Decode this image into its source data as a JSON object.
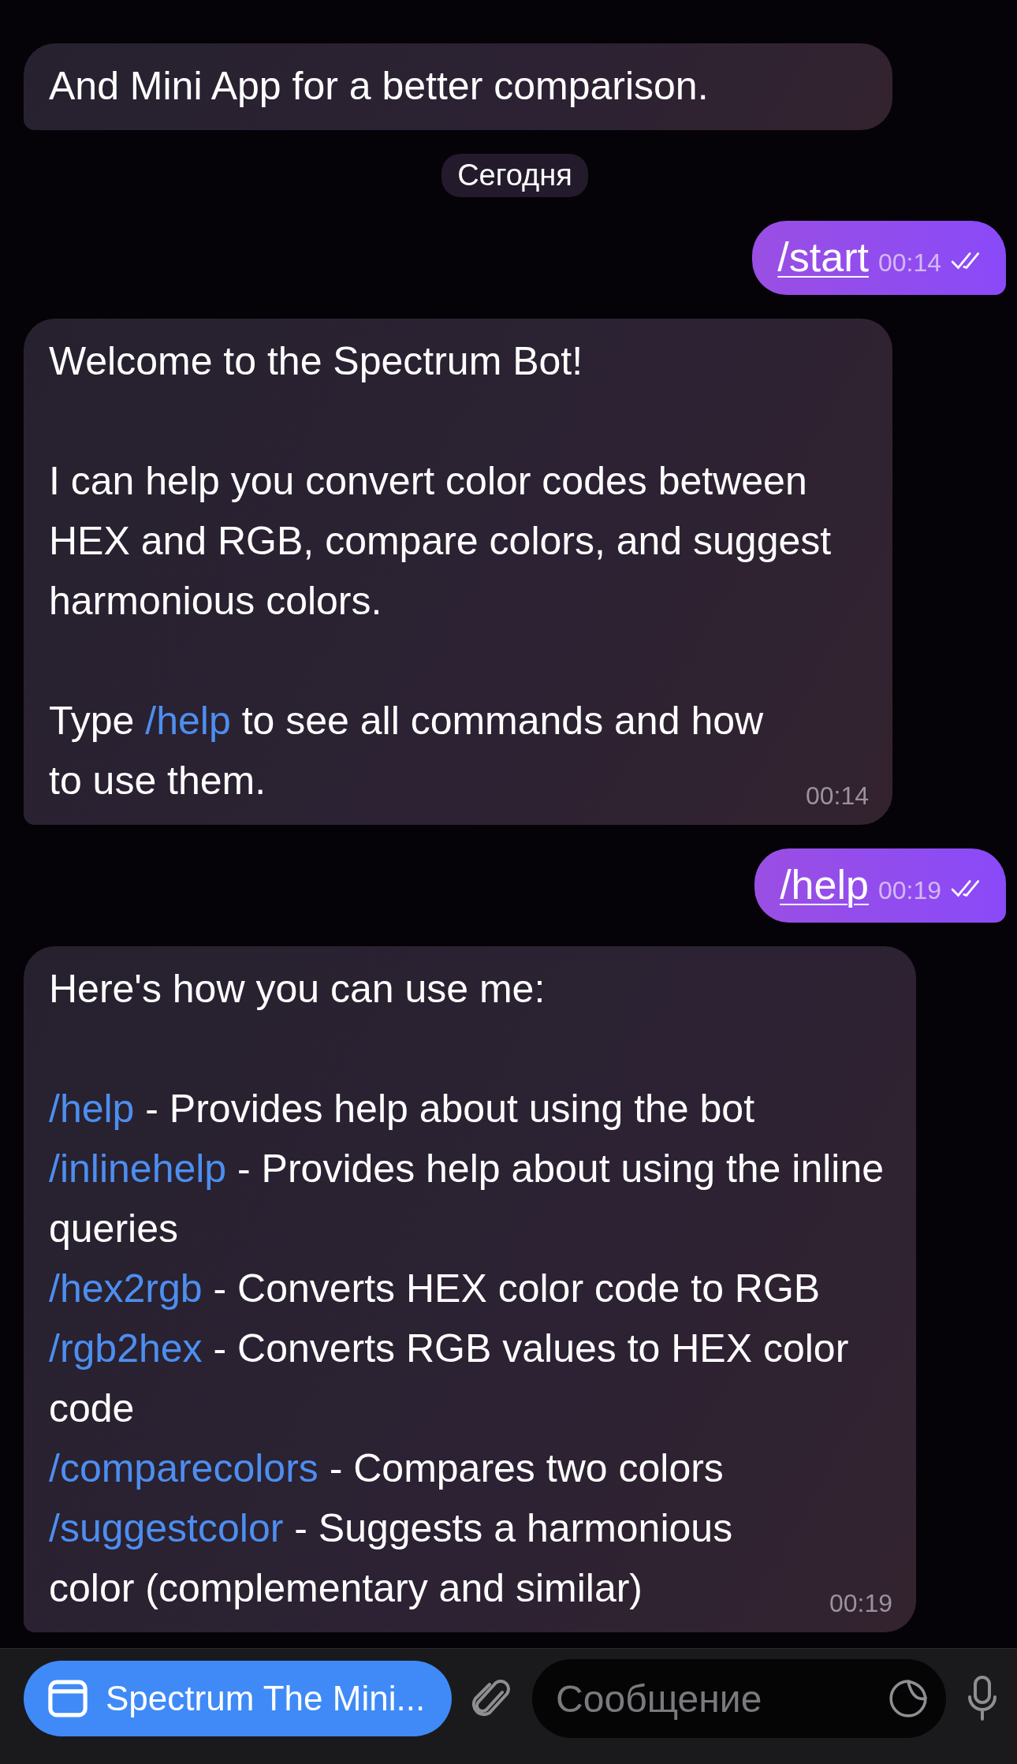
{
  "messages": [
    {
      "kind": "incoming",
      "paragraphs": [
        [
          [
            {
              "kind": "text",
              "text": "And Mini App for a better comparison."
            }
          ]
        ]
      ]
    },
    {
      "kind": "date",
      "text": "Сегодня"
    },
    {
      "kind": "outgoing",
      "text": "/start",
      "time": "00:14",
      "read": true
    },
    {
      "kind": "incoming",
      "time": "00:14",
      "paragraphs": [
        [
          [
            {
              "kind": "text",
              "text": "Welcome to the Spectrum Bot!"
            }
          ]
        ],
        [
          [
            {
              "kind": "text",
              "text": "I can help you convert color codes between HEX and RGB, compare colors, and suggest harmonious colors."
            }
          ]
        ],
        [
          [
            {
              "kind": "text",
              "text": "Type "
            },
            {
              "kind": "command",
              "text": "/help"
            },
            {
              "kind": "text",
              "text": " to see all commands and how to use them."
            }
          ]
        ]
      ]
    },
    {
      "kind": "outgoing",
      "text": "/help",
      "time": "00:19",
      "read": true
    },
    {
      "kind": "incoming",
      "time": "00:19",
      "paragraphs": [
        [
          [
            {
              "kind": "text",
              "text": "Here's how you can use me:"
            }
          ]
        ],
        [
          [
            {
              "kind": "command",
              "text": "/help"
            },
            {
              "kind": "text",
              "text": " - Provides help about using the bot"
            }
          ],
          [
            {
              "kind": "command",
              "text": "/inlinehelp"
            },
            {
              "kind": "text",
              "text": " - Provides help about using the inline queries"
            }
          ],
          [
            {
              "kind": "command",
              "text": "/hex2rgb"
            },
            {
              "kind": "text",
              "text": " - Converts HEX color code to RGB"
            }
          ],
          [
            {
              "kind": "command",
              "text": "/rgb2hex"
            },
            {
              "kind": "text",
              "text": " - Converts RGB values to HEX color code"
            }
          ],
          [
            {
              "kind": "command",
              "text": "/comparecolors"
            },
            {
              "kind": "text",
              "text": " - Compares two colors"
            }
          ],
          [
            {
              "kind": "command",
              "text": "/suggestcolor"
            },
            {
              "kind": "text",
              "text": " - Suggests a harmonious color (complementary and similar)"
            }
          ]
        ]
      ]
    }
  ],
  "input_bar": {
    "app_button": "Spectrum The Mini...",
    "placeholder": "Сообщение"
  }
}
